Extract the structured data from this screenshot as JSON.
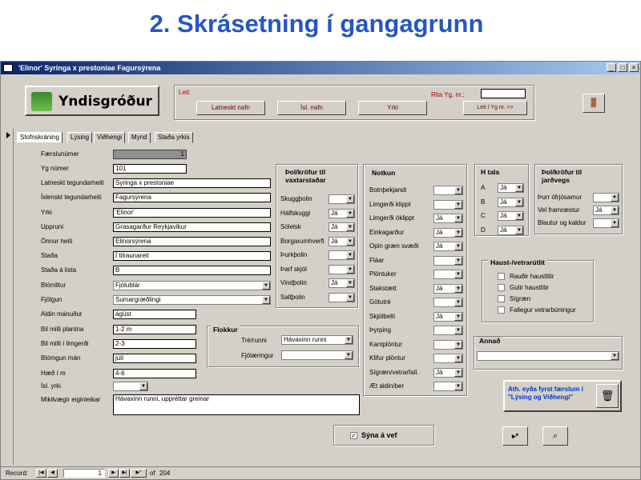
{
  "slide": {
    "title": "2. Skrásetning í gangagrunn"
  },
  "window": {
    "title": "'Elinor' Syringa x prestoniae Fagursýrena",
    "min": "_",
    "max": "□",
    "close": "×"
  },
  "header": {
    "logo": "Yndisgróður",
    "search_label": "Leit:",
    "buttons": [
      "Latneskt nafn",
      "Ísl. nafn",
      "Yrki",
      "Leit í Yg nr. >>"
    ],
    "rita_label": "Rita Yg. nr.:"
  },
  "tabs": [
    "Stofnskráning",
    "Lýsing",
    "Viðhengi",
    "Mynd",
    "Staða yrkis"
  ],
  "fields": [
    {
      "label": "Færslunúmer",
      "value": "1"
    },
    {
      "label": "Yg númer",
      "value": "101"
    },
    {
      "label": "Latneskt tegundarheiti",
      "value": "Syringa x prestoniae"
    },
    {
      "label": "Íslenskt tegundarheiti",
      "value": "Fagursýrena"
    },
    {
      "label": "Yrki",
      "value": "'Elinor'"
    },
    {
      "label": "Uppruni",
      "value": "Grasagarður Reykjavíkur"
    },
    {
      "label": "Önnur heiti",
      "value": "Elinorsýrena"
    },
    {
      "label": "Staða",
      "value": "Í tilraunareit"
    },
    {
      "label": "Staða á lista",
      "value": "B"
    },
    {
      "label": "Blómlitur",
      "value": "Fjólublár"
    },
    {
      "label": "Fjölgun",
      "value": "Sumargræðlingi"
    },
    {
      "label": "Aldin mánuður",
      "value": "ágúst"
    },
    {
      "label": "Bil milli plantna",
      "value": "1-2 m"
    },
    {
      "label": "Bil milli í limgerði",
      "value": "2-3"
    },
    {
      "label": "Blómgun mán",
      "value": "júlí"
    },
    {
      "label": "Hæð í m",
      "value": "4-6"
    },
    {
      "label": "Ísl. yrki",
      "value": ""
    },
    {
      "label": "Mikilvægir eiginleikar",
      "value": "Hávaxinn runni, uppréttar greinar"
    }
  ],
  "flokkur": {
    "title": "Flokkur",
    "rows": [
      {
        "label": "Tré/runni",
        "value": "Hávaxinn runni"
      },
      {
        "label": "Fjölæringur",
        "value": ""
      }
    ]
  },
  "tolerance": {
    "title": "Þol/kröfur til vaxtarstaðar",
    "rows": [
      {
        "label": "Skuggþolin",
        "value": ""
      },
      {
        "label": "Hálfskuggi",
        "value": "Já"
      },
      {
        "label": "Sólelsk",
        "value": "Já"
      },
      {
        "label": "Borgarumhverfi",
        "value": "Já"
      },
      {
        "label": "Þurkþolin",
        "value": ""
      },
      {
        "label": "Þarf skjól",
        "value": ""
      },
      {
        "label": "Vindþolin",
        "value": "Já"
      },
      {
        "label": "Saltþolin",
        "value": ""
      }
    ]
  },
  "notkun": {
    "title": "Notkun",
    "rows": [
      {
        "label": "Botnþekjandi",
        "value": ""
      },
      {
        "label": "Limgerði klippt",
        "value": ""
      },
      {
        "label": "Limgerði óklippt",
        "value": "Já"
      },
      {
        "label": "Einkagarður",
        "value": "Já"
      },
      {
        "label": "Opin græn svæði",
        "value": "Já"
      },
      {
        "label": "Fláar",
        "value": ""
      },
      {
        "label": "Plöntuker",
        "value": ""
      },
      {
        "label": "Stakstætt",
        "value": "Já"
      },
      {
        "label": "Götutré",
        "value": ""
      },
      {
        "label": "Skjólbelti",
        "value": "Já"
      },
      {
        "label": "Þyrping",
        "value": ""
      },
      {
        "label": "Kantplöntur",
        "value": ""
      },
      {
        "label": "Klifur plöntur",
        "value": ""
      },
      {
        "label": "Sígræn/vetrarfall.",
        "value": "Já"
      },
      {
        "label": "Æt aldin/ber",
        "value": ""
      }
    ]
  },
  "htala": {
    "title": "H tala",
    "rows": [
      {
        "label": "A",
        "value": "Já"
      },
      {
        "label": "B",
        "value": "Já"
      },
      {
        "label": "C",
        "value": "Já"
      },
      {
        "label": "D",
        "value": "Já"
      }
    ]
  },
  "soil": {
    "title": "Þol/kröfur til jarðvegs",
    "rows": [
      {
        "label": "Þurr ófrjósamur",
        "value": ""
      },
      {
        "label": "Vel framræstur",
        "value": "Já"
      },
      {
        "label": "Blautur og kaldur",
        "value": ""
      }
    ]
  },
  "autumn": {
    "title": "Haust-/vetrarútlit",
    "items": [
      "Rauðir haustlitir",
      "Gulir haustlitir",
      "Sígræn",
      "Fallegur vetrarbúningur"
    ]
  },
  "annad": {
    "title": "Annað",
    "value": ""
  },
  "delete_note": "Ath. eyða fyrst færslum í \"Lýsing og Viðhengi\"",
  "web": {
    "label": "Sýna á vef",
    "checked": true
  },
  "record": {
    "label": "Record:",
    "current": "1",
    "of": "of",
    "total": "204"
  }
}
